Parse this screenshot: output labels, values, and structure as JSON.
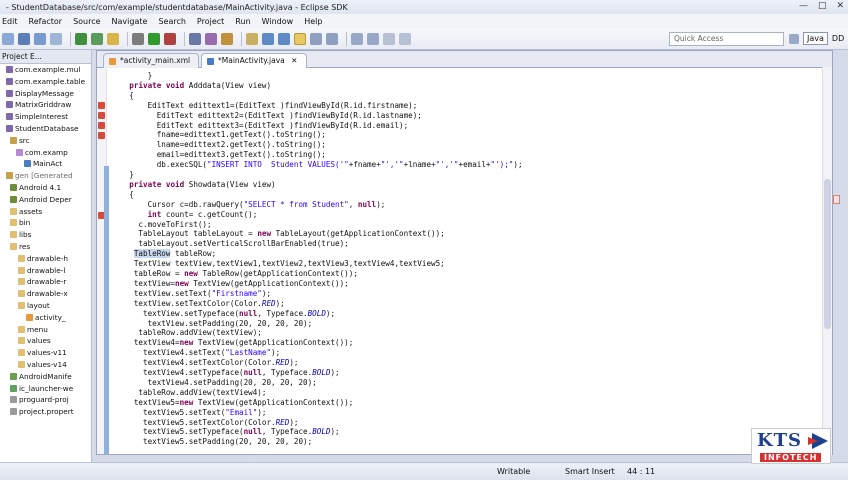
{
  "window": {
    "title": "- StudentDatabase/src/com/example/studentdatabase/MainActivity.java - Eclipse SDK"
  },
  "menu": [
    "Edit",
    "Refactor",
    "Source",
    "Navigate",
    "Search",
    "Project",
    "Run",
    "Window",
    "Help"
  ],
  "toolbar": {
    "quick_access_placeholder": "Quick Access",
    "perspective_java": "Java",
    "perspective_ddms": "DD"
  },
  "explorer": {
    "title": "Project E...",
    "items": [
      {
        "label": "com.example.mul"
      },
      {
        "label": "com.example.table"
      },
      {
        "label": "DisplayMessage"
      },
      {
        "label": "MatrixGriddraw"
      },
      {
        "label": "SimpleInterest"
      },
      {
        "label": "StudentDatabase"
      },
      {
        "label": "src"
      },
      {
        "label": "com.examp"
      },
      {
        "label": "MainAct"
      },
      {
        "label": "gen [Generated"
      },
      {
        "label": "Android 4.1"
      },
      {
        "label": "Android Deper"
      },
      {
        "label": "assets"
      },
      {
        "label": "bin"
      },
      {
        "label": "libs"
      },
      {
        "label": "res"
      },
      {
        "label": "drawable-h"
      },
      {
        "label": "drawable-l"
      },
      {
        "label": "drawable-r"
      },
      {
        "label": "drawable-x"
      },
      {
        "label": "layout"
      },
      {
        "label": "activity_"
      },
      {
        "label": "menu"
      },
      {
        "label": "values"
      },
      {
        "label": "values-v11"
      },
      {
        "label": "values-v14"
      },
      {
        "label": "AndroidManife"
      },
      {
        "label": "ic_launcher-we"
      },
      {
        "label": "proguard-proj"
      },
      {
        "label": "project.propert"
      }
    ]
  },
  "tabs": [
    {
      "label": "*activity_main.xml"
    },
    {
      "label": "*MainActivity.java"
    }
  ],
  "code_lines": [
    "        }",
    "    private void Adddata(View view)",
    "    {",
    "        EditText edittext1=(EditText )findViewById(R.id.firstname);",
    "          EditText edittext2=(EditText )findViewById(R.id.lastname);",
    "          EditText edittext3=(EditText )findViewById(R.id.email);",
    "          fname=edittext1.getText().toString();",
    "          lname=edittext2.getText().toString();",
    "          email=edittext3.getText().toString();",
    "          db.execSQL(\"INSERT INTO  Student VALUES('\"+fname+\"','\"+lname+\"','\"+email+\"');\");",
    "    }",
    "    private void Showdata(View view)",
    "    {",
    "        Cursor c=db.rawQuery(\"SELECT * from Student\", null);",
    "        int count= c.getCount();",
    "      c.moveToFirst();",
    "      TableLayout tableLayout = new TableLayout(getApplicationContext());",
    "      tableLayout.setVerticalScrollBarEnabled(true);",
    "     TableRow tableRow;",
    "     TextView textView,textView1,textView2,textView3,textView4,textView5;",
    "     tableRow = new TableRow(getApplicationContext());",
    "     textView=new TextView(getApplicationContext());",
    "     textView.setText(\"Firstname\");",
    "     textView.setTextColor(Color.RED);",
    "       textView.setTypeface(null, Typeface.BOLD);",
    "        textView.setPadding(20, 20, 20, 20);",
    "      tableRow.addView(textView);",
    "     textView4=new TextView(getApplicationContext());",
    "       textView4.setText(\"LastName\");",
    "       textView4.setTextColor(Color.RED);",
    "       textView4.setTypeface(null, Typeface.BOLD);",
    "        textView4.setPadding(20, 20, 20, 20);",
    "      tableRow.addView(textView4);",
    "     textView5=new TextView(getApplicationContext());",
    "       textView5.setText(\"Email\");",
    "       textView5.setTextColor(Color.RED);",
    "       textView5.setTypeface(null, Typeface.BOLD);",
    "       textView5.setPadding(20, 20, 20, 20);"
  ],
  "status": {
    "mode": "Writable",
    "insert": "Smart Insert",
    "position": "44 : 11"
  },
  "logo": {
    "text": "KTS",
    "sub": "INFOTECH"
  },
  "colors": {
    "keyword": "#7f0055",
    "string": "#2a00ff",
    "field": "#0000c0",
    "selection": "#c7d8f1",
    "error": "#d84a3a"
  }
}
